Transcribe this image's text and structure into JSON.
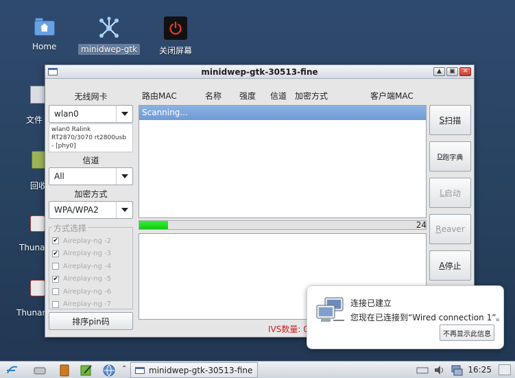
{
  "desktop": {
    "icons": [
      {
        "label": "Home"
      },
      {
        "label": "minidwep-gtk"
      },
      {
        "label": "关闭屏幕"
      }
    ],
    "side_labels": [
      "文件",
      "回收",
      "Thuna",
      "Thunar"
    ]
  },
  "window": {
    "title": "minidwep-gtk-30513-fine",
    "left": {
      "wireless_label": "无线网卡",
      "wireless_value": "wlan0",
      "adapter_info": "wlan0 Ralink RT2870/3070 rt2800usb - [phy0]",
      "channel_label": "信道",
      "channel_value": "All",
      "encryption_label": "加密方式",
      "encryption_value": "WPA/WPA2",
      "method_legend": "方式选择",
      "methods": [
        {
          "label": "Aireplay-ng -2",
          "checked": true
        },
        {
          "label": "Aireplay-ng -3",
          "checked": true
        },
        {
          "label": "Aireplay-ng -4",
          "checked": false
        },
        {
          "label": "Aireplay-ng -5",
          "checked": true
        },
        {
          "label": "Aireplay-ng -6",
          "checked": false
        },
        {
          "label": "Aireplay-ng -7",
          "checked": false
        }
      ],
      "pin_button": "排序pin码"
    },
    "headers": {
      "router_mac": "路由MAC",
      "name": "名称",
      "strength": "强度",
      "channel": "信道",
      "encryption": "加密方式",
      "client_mac": "客户端MAC"
    },
    "scan_status": "Scanning...",
    "progress": {
      "percent": 10,
      "count": "24"
    },
    "ivs_label": "IVS数量: 0",
    "buttons": {
      "scan": {
        "key": "S",
        "text": "扫描"
      },
      "dict": {
        "key": "D",
        "text": "跑字典"
      },
      "launch": {
        "key": "L",
        "text": "启动"
      },
      "reaver": {
        "key": "R",
        "text": "eaver"
      },
      "stop": {
        "key": "A",
        "text": "停止"
      }
    },
    "controls": {
      "up": "▲",
      "max": "▣",
      "close": "✕"
    }
  },
  "notification": {
    "title": "连接已建立",
    "body": "您现在已连接到“Wired connection 1”。",
    "button": "不再显示此信息"
  },
  "taskbar": {
    "task_label": "minidwep-gtk-30513-fine",
    "clock": "16:25"
  },
  "colors": {
    "selection": "#7aa3dc",
    "progress_fill": "#22dd22",
    "ivs_text": "#cc1e1e",
    "close_button": "#d2483d"
  }
}
